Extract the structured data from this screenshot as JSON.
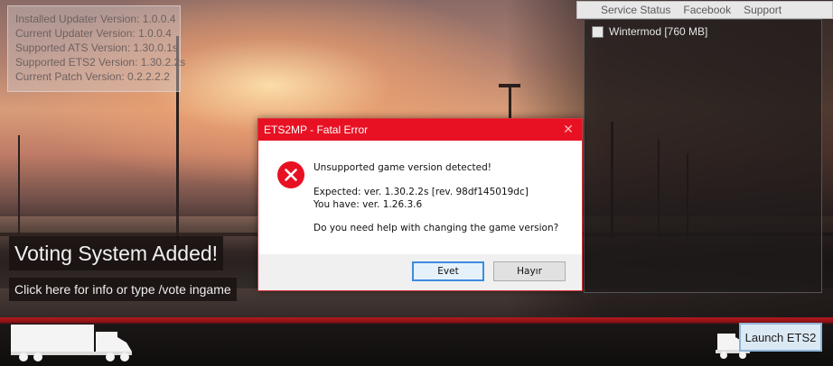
{
  "version_info": {
    "lines": [
      "Installed Updater Version: 1.0.0.4",
      "Current Updater Version: 1.0.0.4",
      "Supported ATS Version: 1.30.0.1s",
      "Supported ETS2 Version: 1.30.2.2s",
      "Current Patch Version: 0.2.2.2.2"
    ]
  },
  "top_menu": {
    "items": [
      "Service Status",
      "Facebook",
      "Support"
    ]
  },
  "mods": {
    "items": [
      {
        "label": "Wintermod [760 MB]",
        "checked": false
      }
    ]
  },
  "voting": {
    "title": "Voting System Added!",
    "subtitle": "Click here for info or type /vote ingame"
  },
  "launch": {
    "label": "Launch ETS2"
  },
  "dialog": {
    "title": "ETS2MP - Fatal Error",
    "close_glyph": "✕",
    "line1": "Unsupported game version detected!",
    "expected": "Expected: ver. 1.30.2.2s [rev. 98df145019dc]",
    "have": "You have: ver. 1.26.3.6",
    "question": "Do you need help with changing the game version?",
    "yes_label": "Evet",
    "no_label": "Hayır"
  },
  "colors": {
    "dialog_title_bar": "#e81123",
    "error_icon": "#e81123",
    "primary_button_border": "#3c8be0",
    "bottom_bar_red": "#b11a1f"
  },
  "icons": {
    "error": "error-circle-x-icon",
    "truck": "truck-icon",
    "checkbox": "checkbox-icon"
  }
}
